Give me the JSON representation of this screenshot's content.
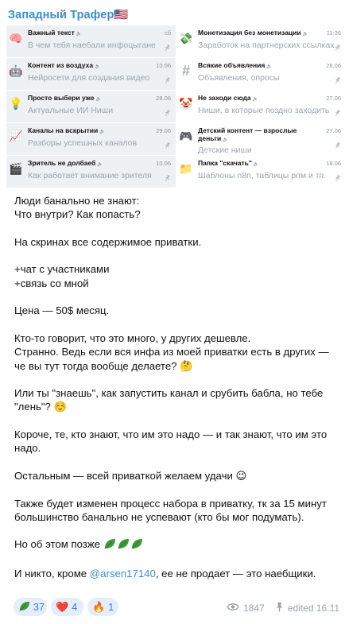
{
  "channel": {
    "title": "Западный Трафер🇺🇸"
  },
  "pinned": [
    {
      "icon": "🧠",
      "icon_name": "brain-icon",
      "title": "Важный текст",
      "date": "сб",
      "subtitle": "В чем тебя наебали инфоцыгане"
    },
    {
      "icon": "💸",
      "icon_name": "money-icon",
      "title": "Монетизация без монетизации",
      "date": "11:36",
      "subtitle": "Заработок на партнерских ссылках"
    },
    {
      "icon": "🤖",
      "icon_name": "robot-icon",
      "title": "Контент из воздуха",
      "date": "10.06",
      "subtitle": "Нейросети для создания видео"
    },
    {
      "icon": "#",
      "icon_name": "hashtag-icon",
      "title": "Всякие объявления",
      "date": "28.06",
      "subtitle": "Объявления, опросы"
    },
    {
      "icon": "💡",
      "icon_name": "lightbulb-icon",
      "title": "Просто выбери уже",
      "date": "28.06",
      "subtitle": "Актуальные ИИ Ниши"
    },
    {
      "icon": "🤡",
      "icon_name": "clown-icon",
      "title": "Не заходи сюда",
      "date": "27.06",
      "subtitle": "Ниши, в которые поздно заходить"
    },
    {
      "icon": "📈",
      "icon_name": "chart-up-icon",
      "title": "Каналы на вскрытии",
      "date": "29.06",
      "subtitle": "Разборы успешных каналов"
    },
    {
      "icon": "🎮",
      "icon_name": "gamepad-icon",
      "title": "Детский контент — взрослые деньги",
      "date": "27.06",
      "subtitle": "Детские ниши"
    },
    {
      "icon": "🎬",
      "icon_name": "clapper-icon",
      "title": "Зритель не долбаеб",
      "date": "10.06",
      "subtitle": "Как работает внимание зрителя"
    },
    {
      "icon": "📁",
      "icon_name": "folder-icon",
      "title": "Папка \"скачать\"",
      "date": "18.06",
      "subtitle": "Шаблоны n8n, таблицы рпм и тп."
    }
  ],
  "message": {
    "l1": "Люди банально не знают:",
    "l2": "Что внутри? Как попасть?",
    "l3": "На скринах все содержимое приватки.",
    "l4": "+чат с участниками",
    "l5": "+связь со мной",
    "l6": "Цена — 50$ месяц.",
    "l7": "Кто-то говорит, что это много, у других дешевле.",
    "l8": "Странно. Ведь если вся инфа из моей приватки есть в других — че вы тут тогда вообще делаете? 🤔",
    "l9": "Или ты \"знаешь\", как запустить канал и срубить бабла, но тебе \"лень\"? ☺️",
    "l10": "Короче, те, кто знают, что им это надо — и так знают, что им это надо.",
    "l11": "Остальным — всей приваткой желаем удачи 😉",
    "l12": "Также будет изменен процесс набора в приватку, тк за 15 минут большинство банально не успевают (кто бы мог подумать).",
    "l13": "Но об этом позже",
    "l14_pre": "И никто, кроме ",
    "l14_mention": "@arsen17140",
    "l14_post": ", ее не продает — это наебщики."
  },
  "reactions": [
    {
      "emoji": "🍃",
      "icon_name": "leaf-icon",
      "count": "37"
    },
    {
      "emoji": "❤️",
      "icon_name": "heart-icon",
      "count": "4"
    },
    {
      "emoji": "🔥",
      "icon_name": "fire-icon",
      "count": "1"
    }
  ],
  "meta": {
    "views": "1847",
    "edited": "edited 16:11"
  },
  "colors": {
    "accent": "#3a8fc7",
    "reaction_bg": "#e3eefa",
    "leaf": "#3d9a3a"
  }
}
